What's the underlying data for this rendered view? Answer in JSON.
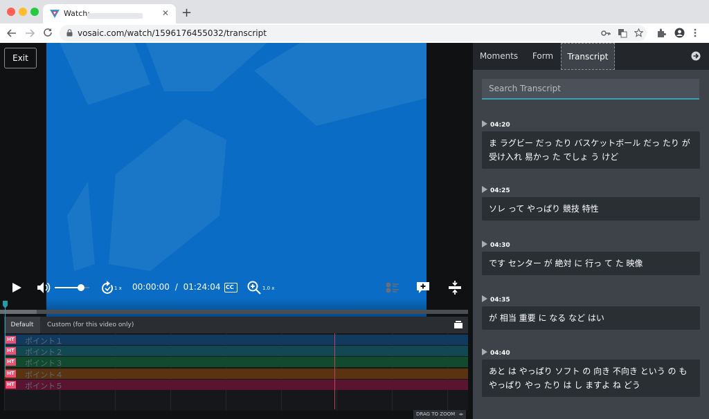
{
  "browser": {
    "tab_title": "Watch:",
    "url": "vosaic.com/watch/1596176455032/transcript",
    "tab_close": "✕",
    "new_tab": "+"
  },
  "player": {
    "exit_label": "Exit",
    "current_time": "00:00:00",
    "time_separator": "/",
    "duration": "01:24:04",
    "replay_rate": "1 x",
    "zoom_rate": "1.0 x",
    "cc_label": "CC",
    "volume_level": 0.75
  },
  "timeline": {
    "tab_default": "Default",
    "tab_custom": "Custom (for this video only)",
    "drag_to_zoom": "DRAG TO ZOOM",
    "tracks": [
      {
        "tag": "HT",
        "label": "ポイント１",
        "color": "#123a5e"
      },
      {
        "tag": "HT",
        "label": "ポイント２",
        "color": "#114852"
      },
      {
        "tag": "HT",
        "label": "ポイント３",
        "color": "#114a2c"
      },
      {
        "tag": "HT",
        "label": "ポイント４",
        "color": "#5a3412"
      },
      {
        "tag": "HT",
        "label": "ポイント５",
        "color": "#5a1430"
      }
    ]
  },
  "panel": {
    "tabs": [
      "Moments",
      "Form",
      "Transcript"
    ],
    "search_placeholder": "Search Transcript",
    "entries": [
      {
        "time": "04:20",
        "text": "ま ラグビー だっ たり バスケットボール だっ たり が 受け入れ 易かっ た でしょ う けど"
      },
      {
        "time": "04:25",
        "text": "ソレ って やっぱり 競技 特性"
      },
      {
        "time": "04:30",
        "text": "です センター が 絶対 に 行っ て た 映像"
      },
      {
        "time": "04:35",
        "text": "が 相当 重要 に なる など はい"
      },
      {
        "time": "04:40",
        "text": "あと は やっぱり ソフト の 向き 不向き という の も やっぱり やっ たり は し ますよ ね どう"
      }
    ]
  },
  "colors": {
    "video_blue": "#0a6cc4",
    "accent_teal": "#3d9fb2",
    "tag_pink": "#f04d70"
  }
}
